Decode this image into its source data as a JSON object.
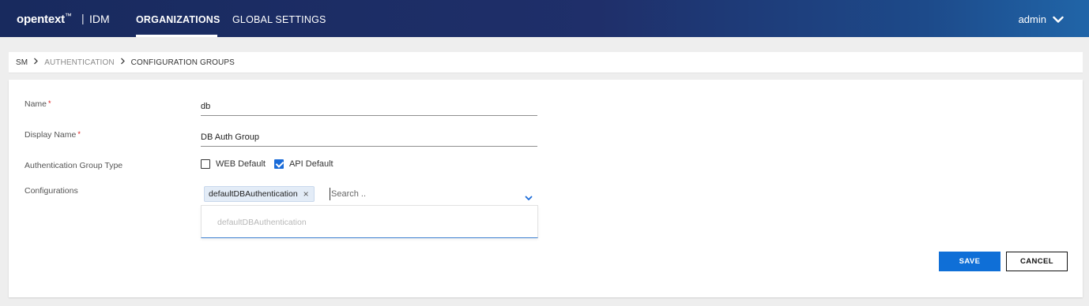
{
  "header": {
    "logo_text": "opentext",
    "logo_tm": "™",
    "separator": "|",
    "product": "IDM",
    "nav": [
      {
        "label": "ORGANIZATIONS",
        "active": true
      },
      {
        "label": "GLOBAL SETTINGS",
        "active": false
      }
    ],
    "user": "admin",
    "user_icon": "chevron-down-icon"
  },
  "breadcrumb": {
    "items": [
      "SM",
      "AUTHENTICATION",
      "CONFIGURATION GROUPS"
    ],
    "separator_icon": "chevron-right-icon"
  },
  "form": {
    "name": {
      "label": "Name",
      "required_mark": "*",
      "value": "db"
    },
    "display_name": {
      "label": "Display Name",
      "required_mark": "*",
      "value": "DB Auth Group"
    },
    "group_type": {
      "label": "Authentication Group Type",
      "options": [
        {
          "label": "WEB Default",
          "checked": false
        },
        {
          "label": "API Default",
          "checked": true
        }
      ]
    },
    "configurations": {
      "label": "Configurations",
      "selected_chips": [
        "defaultDBAuthentication"
      ],
      "chip_remove_glyph": "×",
      "search_placeholder": "Search ..",
      "dropdown_options": [
        "defaultDBAuthentication"
      ]
    }
  },
  "actions": {
    "save_label": "SAVE",
    "cancel_label": "CANCEL"
  },
  "colors": {
    "header_start": "#182a5e",
    "header_end": "#2065a8",
    "primary_button": "#0f6fd7",
    "checkbox_checked": "#1a6bd8",
    "required": "#dd1111"
  }
}
